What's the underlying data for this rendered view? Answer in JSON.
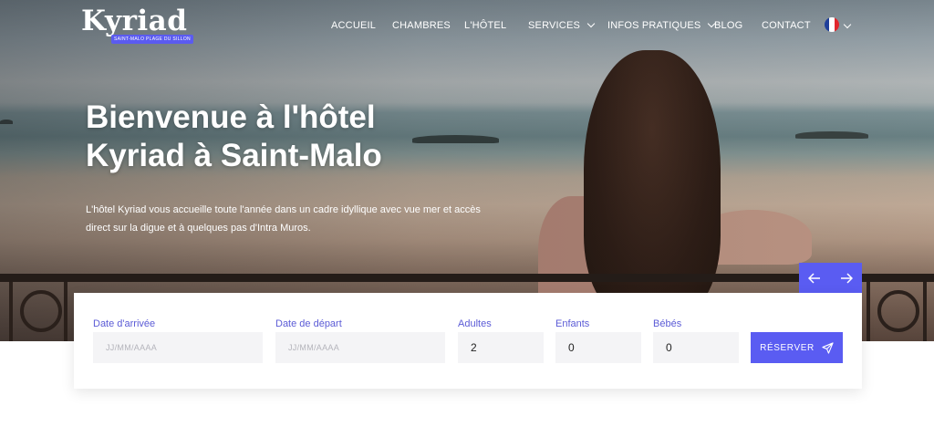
{
  "brand": {
    "name": "Kyriad",
    "tagline": "SAINT-MALO PLAGE DU SILLON"
  },
  "nav": {
    "items": [
      {
        "label": "ACCUEIL"
      },
      {
        "label": "CHAMBRES"
      },
      {
        "label": "L'HÔTEL"
      },
      {
        "label": "SERVICES"
      },
      {
        "label": "INFOS PRATIQUES"
      },
      {
        "label": "BLOG"
      },
      {
        "label": "CONTACT"
      }
    ],
    "language_icon": "france-flag-icon"
  },
  "hero": {
    "title_line1": "Bienvenue à l'hôtel",
    "title_line2": "Kyriad à Saint-Malo",
    "subtitle": "L'hôtel Kyriad vous accueille toute l'année dans un cadre idyllique avec vue mer et accès direct sur la digue et à quelques pas d'Intra Muros.",
    "prev_icon": "arrow-left-icon",
    "next_icon": "arrow-right-icon"
  },
  "booking": {
    "arrival": {
      "label": "Date d'arrivée",
      "placeholder": "JJ/MM/AAAA",
      "value": ""
    },
    "departure": {
      "label": "Date de départ",
      "placeholder": "JJ/MM/AAAA",
      "value": ""
    },
    "adults": {
      "label": "Adultes",
      "value": "2"
    },
    "children": {
      "label": "Enfants",
      "value": "0"
    },
    "babies": {
      "label": "Bébés",
      "value": "0"
    },
    "submit_label": "RÉSERVER",
    "submit_icon": "paper-plane-icon"
  },
  "colors": {
    "accent": "#5a5cf2",
    "label": "#5b5bd6",
    "field_bg": "#f4f4f6"
  }
}
